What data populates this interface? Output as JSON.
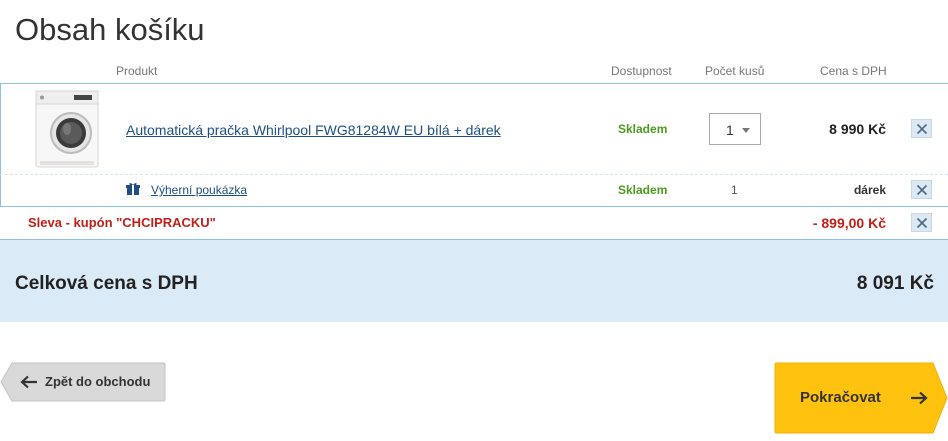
{
  "page": {
    "title": "Obsah košíku"
  },
  "table_headers": {
    "product": "Produkt",
    "availability": "Dostupnost",
    "quantity": "Počet kusů",
    "price": "Cena s DPH"
  },
  "items": [
    {
      "name": "Automatická pračka Whirlpool FWG81284W EU bílá + dárek",
      "availability": "Skladem",
      "quantity": "1",
      "price": "8 990 Kč",
      "image_icon": "washing-machine-image"
    },
    {
      "name": "Výherní poukázka",
      "availability": "Skladem",
      "quantity": "1",
      "price": "dárek",
      "icon": "gift-icon"
    }
  ],
  "discount": {
    "label": "Sleva - kupón \"CHCIPRACKU\"",
    "amount": "- 899,00 Kč"
  },
  "total": {
    "label": "Celková cena s DPH",
    "value": "8 091 Kč"
  },
  "buttons": {
    "back_label": "Zpět do obchodu",
    "continue_label": "Pokračovat"
  },
  "colors": {
    "availability_green": "#4d9a1f",
    "discount_red": "#c0201a",
    "link_blue": "#1e4f82",
    "total_bar_bg": "#dbeaf7",
    "continue_yellow": "#ffc20e"
  }
}
